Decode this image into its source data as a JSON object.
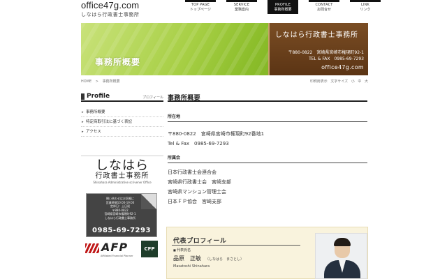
{
  "header": {
    "logo_main": "office47g.com",
    "logo_sub": "しなはら行政書士事務所",
    "nav": [
      {
        "en": "TOP PAGE",
        "ja": "トップページ",
        "active": false
      },
      {
        "en": "SERVICE",
        "ja": "業務案内",
        "active": false
      },
      {
        "en": "PROFILE",
        "ja": "事務所概要",
        "active": true
      },
      {
        "en": "CONTACT",
        "ja": "お問合せ",
        "active": false
      },
      {
        "en": "LINK",
        "ja": "リンク",
        "active": false
      }
    ]
  },
  "banner": {
    "title": "事務所概要",
    "card_name": "しなはら行政書士事務所",
    "card_address": "〒880-0822　宮崎県宮崎市権現町92-1",
    "card_tel": "TEL & FAX　0985-69-7293",
    "card_domain": "office47g.com"
  },
  "breadcrumb": {
    "home": "HOME",
    "sep": ">",
    "current": "事務所概要"
  },
  "util": {
    "print": "印刷用表示",
    "font_size": "文字サイズ",
    "small": "小",
    "medium": "中",
    "large": "大"
  },
  "sidebar": {
    "heading": "Profile",
    "heading_ja": "プロフィール",
    "items": [
      "事務所概要",
      "特定商取引法に基づく表記",
      "アクセス"
    ],
    "logo_a": "しなはら",
    "logo_b": "行政書士事務所",
    "logo_c": "Shinahara Administrative scrivener Office",
    "contact_lines": [
      "閉い合わせはお気軽に",
      "営業時間10:00-19:00",
      "定休日：土日祝",
      "〒880-0822",
      "宮崎県宮崎市権現町92-1",
      "しなはら行政書士事務所"
    ],
    "contact_tel": "0985-69-7293",
    "afp": "AFP",
    "afp_sub": "Affiliated Financial Planner",
    "cfp": "CFP"
  },
  "main": {
    "title": "事務所概要",
    "section1_head": "所在地",
    "section1_lines": [
      "〒880-0822　宮崎県宮崎市権現町92番地1",
      "Tel & Fax　0985-69-7293"
    ],
    "section2_head": "所属会",
    "section2_lines": [
      "日本行政書士会連合会",
      "宮崎県行政書士会　宮崎支部",
      "宮崎県マンション管理士会",
      "日本ＦＰ協会　宮崎支部"
    ]
  },
  "profile": {
    "heading": "代表プロフィール",
    "label": "代表氏名",
    "name": "品原　正敏",
    "kana": "（しなはら　まさとし）",
    "name_en": "Masatoshi Shinahara"
  }
}
